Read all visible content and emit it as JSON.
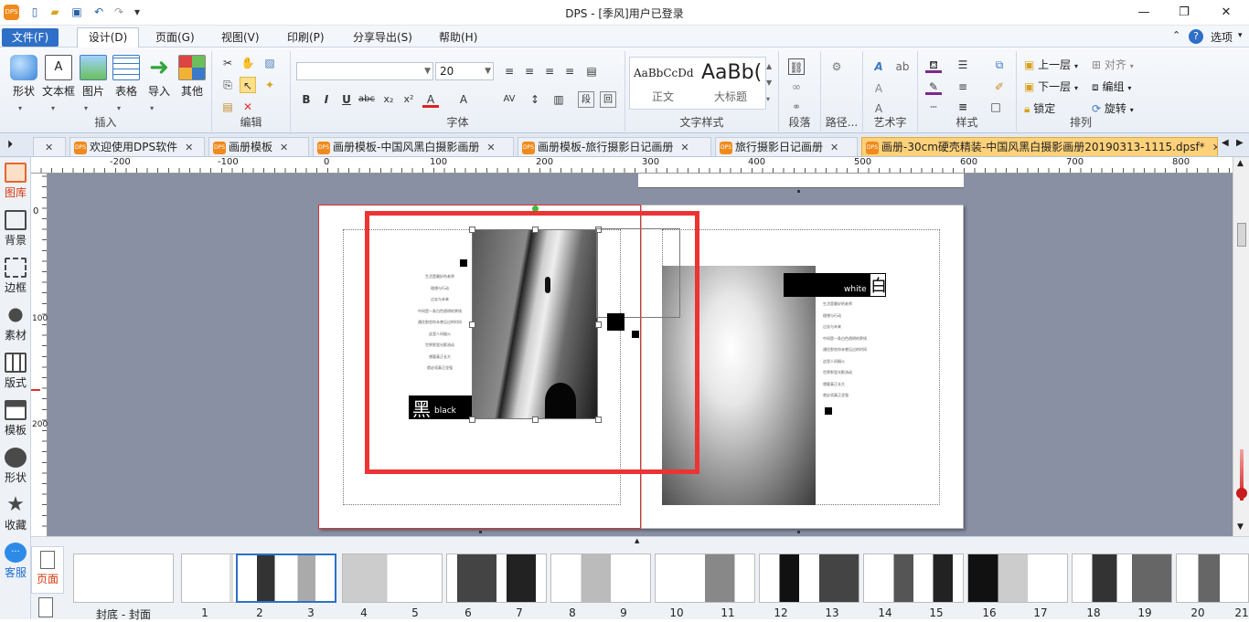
{
  "window": {
    "title": "DPS - [季风]用户已登录"
  },
  "menubar": {
    "file": "文件(F)",
    "items": [
      "设计(D)",
      "页面(G)",
      "视图(V)",
      "印刷(P)",
      "分享导出(S)",
      "帮助(H)"
    ],
    "options": "选项"
  },
  "ribbon": {
    "insert": {
      "label": "插入",
      "buttons": [
        "形状",
        "文本框",
        "图片",
        "表格",
        "导入",
        "其他"
      ]
    },
    "edit": {
      "label": "编辑"
    },
    "font": {
      "label": "字体",
      "size": "20"
    },
    "textstyle": {
      "label": "文字样式",
      "normal": "正文",
      "heading_label": "大标题",
      "sample_normal": "AaBbCcDd",
      "sample_heading": "AaBb("
    },
    "paragraph": {
      "label": "段落"
    },
    "path": {
      "label": "路径..."
    },
    "arttext": {
      "label": "艺术字"
    },
    "style": {
      "label": "样式"
    },
    "arrange": {
      "label": "排列",
      "up": "上一层",
      "down": "下一层",
      "lock": "锁定",
      "align": "对齐",
      "group": "编组",
      "rotate": "旋转"
    }
  },
  "tabs": [
    {
      "label": ""
    },
    {
      "label": "欢迎使用DPS软件"
    },
    {
      "label": "画册模板"
    },
    {
      "label": "画册模板-中国风黑白摄影画册"
    },
    {
      "label": "画册模板-旅行摄影日记画册"
    },
    {
      "label": "旅行摄影日记画册"
    },
    {
      "label": "画册-30cm硬壳精装-中国风黑白摄影画册20190313-1115.dpsf*"
    }
  ],
  "leftpanel": [
    "图库",
    "背景",
    "边框",
    "素材",
    "版式",
    "模板",
    "形状",
    "收藏",
    "客服"
  ],
  "rulers": {
    "h": [
      "-200",
      "-100",
      "0",
      "100",
      "200",
      "300",
      "400",
      "500",
      "600",
      "700",
      "800"
    ],
    "v": [
      "0",
      "100",
      "200"
    ]
  },
  "spread": {
    "left": {
      "label_cn": "黑",
      "label_en": "black",
      "poem": [
        "生活是最好的老师",
        "理想与行动",
        "过去与未来",
        "中间是一条白色透明的界线",
        "通往那些你未曾见过的时间",
        "这里人间烟火",
        "世界那里光影流动",
        "想要真正长大",
        "就必须真正坚强"
      ]
    },
    "right": {
      "label_cn": "白",
      "label_en": "white",
      "poem": [
        "生活是最好的老师",
        "理想与行动",
        "过去与未来",
        "中间是一条白色透明的界线",
        "通往那些你未曾见过的时间",
        "这里人间烟火",
        "世界那里光影流动",
        "想要真正长大",
        "就必须真正坚强"
      ]
    }
  },
  "pagepanel": {
    "page_label": "页面"
  },
  "thumbnails": {
    "cover_label": "封底 - 封面",
    "numbers": [
      "1",
      "2",
      "3",
      "4",
      "5",
      "6",
      "7",
      "8",
      "9",
      "10",
      "11",
      "12",
      "13",
      "14",
      "15",
      "16",
      "17",
      "18",
      "19",
      "20",
      "21"
    ]
  },
  "colors": {
    "accent": "#2e6fc7",
    "selection": "#ec3434",
    "canvas": "#8990a4",
    "active_tab": "#ffd27a"
  }
}
